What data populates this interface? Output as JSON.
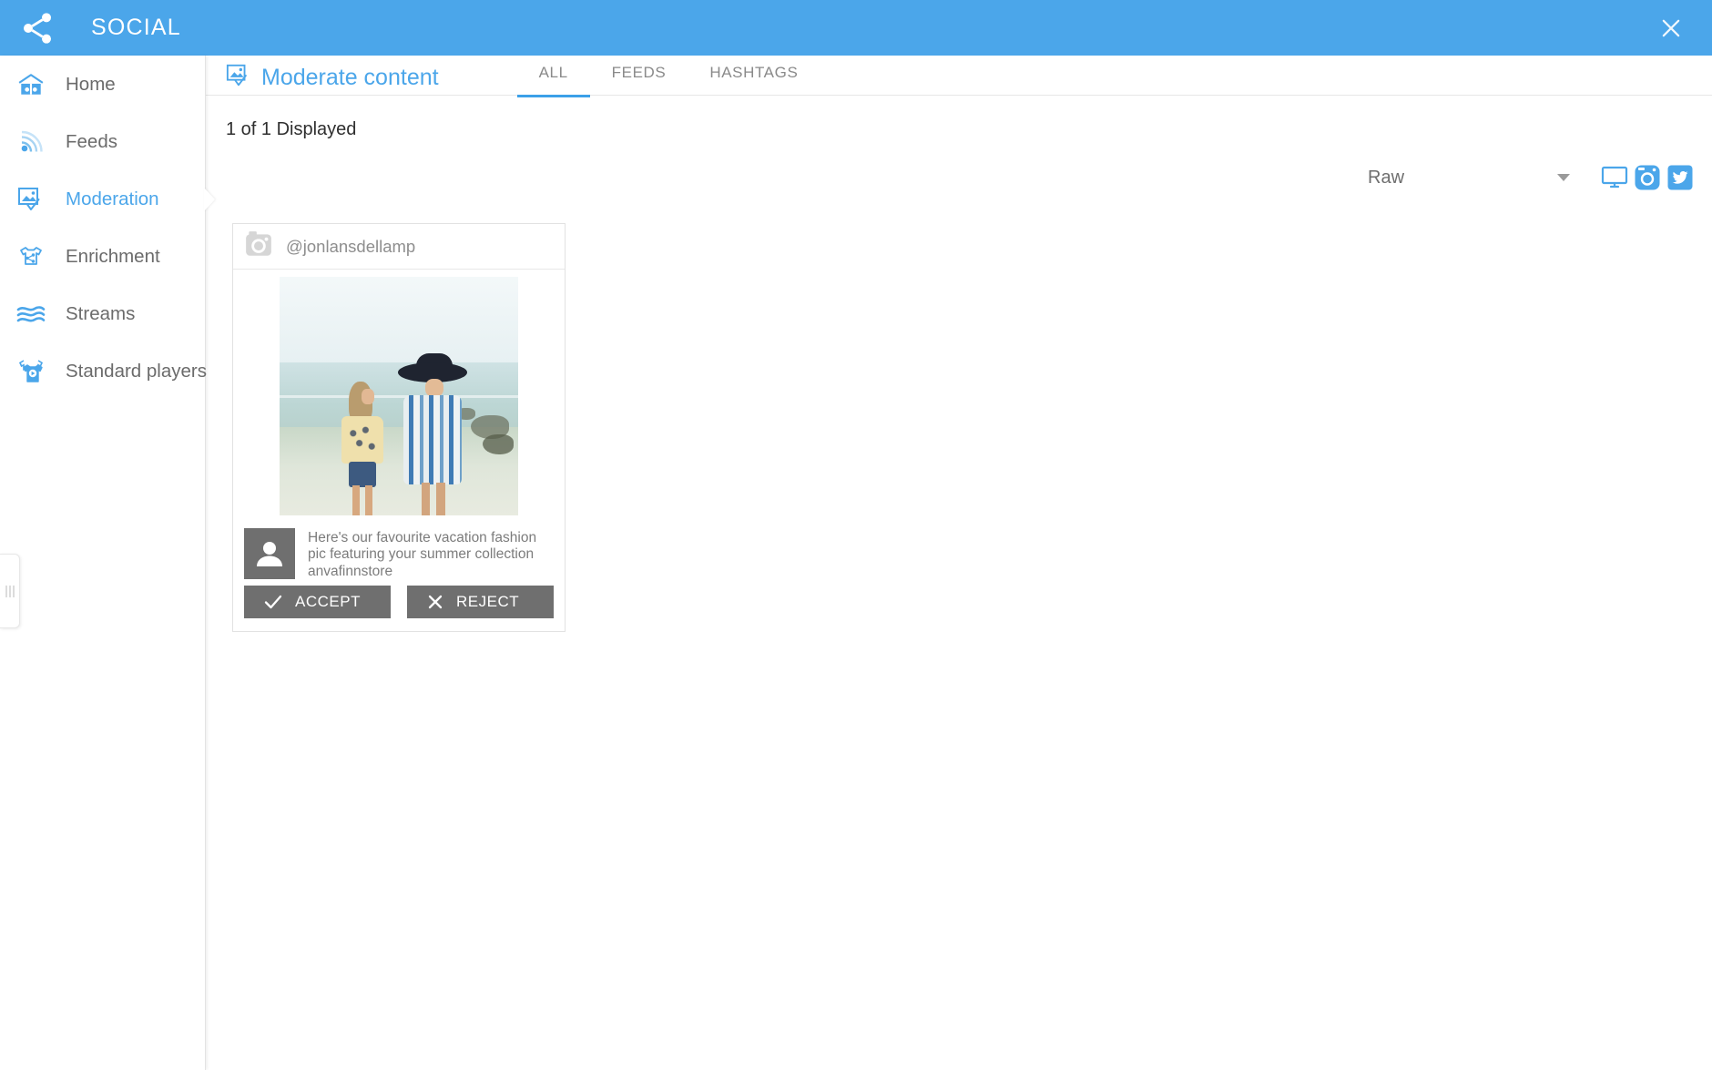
{
  "app": {
    "brand_title": "SOCIAL",
    "brand_icon": "share-icon",
    "close_icon": "close-icon",
    "header_color": "#4BA6EA"
  },
  "sidebar": {
    "items": [
      {
        "label": "Home",
        "icon": "home-icon",
        "active": false
      },
      {
        "label": "Feeds",
        "icon": "rss-feed-icon",
        "active": false
      },
      {
        "label": "Moderation",
        "icon": "image-check-icon",
        "active": true
      },
      {
        "label": "Enrichment",
        "icon": "tshirt-share-icon",
        "active": false
      },
      {
        "label": "Streams",
        "icon": "waves-icon",
        "active": false
      },
      {
        "label": "Standard players",
        "icon": "jersey-player-icon",
        "active": false
      }
    ],
    "collapse_handle": "drag-handle-icon"
  },
  "content": {
    "page_title": "Moderate content",
    "page_title_icon": "image-check-icon",
    "tabs": [
      {
        "label": "ALL",
        "active": true
      },
      {
        "label": "FEEDS",
        "active": false
      },
      {
        "label": "HASHTAGS",
        "active": false
      }
    ],
    "count_text": "1 of 1 Displayed",
    "toolbar": {
      "select_value": "Raw",
      "select_caret": "chevron-down-icon",
      "icons": [
        {
          "name": "monitor-icon"
        },
        {
          "name": "instagram-icon"
        },
        {
          "name": "twitter-icon"
        }
      ]
    }
  },
  "card": {
    "source_icon": "instagram-icon",
    "handle": "@jonlansdellamp",
    "photo_alt": "two women standing on a rocky beach by the sea",
    "avatar_icon": "user-avatar-icon",
    "caption": "Here's our favourite vacation fashion pic featuring your summer collection anvafinnstore",
    "accept_label": "ACCEPT",
    "accept_icon": "check-icon",
    "reject_label": "REJECT",
    "reject_icon": "close-x-icon"
  },
  "colors": {
    "accent": "#4BA6EA",
    "tab_underline": "#3BA0E8",
    "button_gray": "#6F6F6F",
    "text_gray": "#6B6B6B"
  }
}
